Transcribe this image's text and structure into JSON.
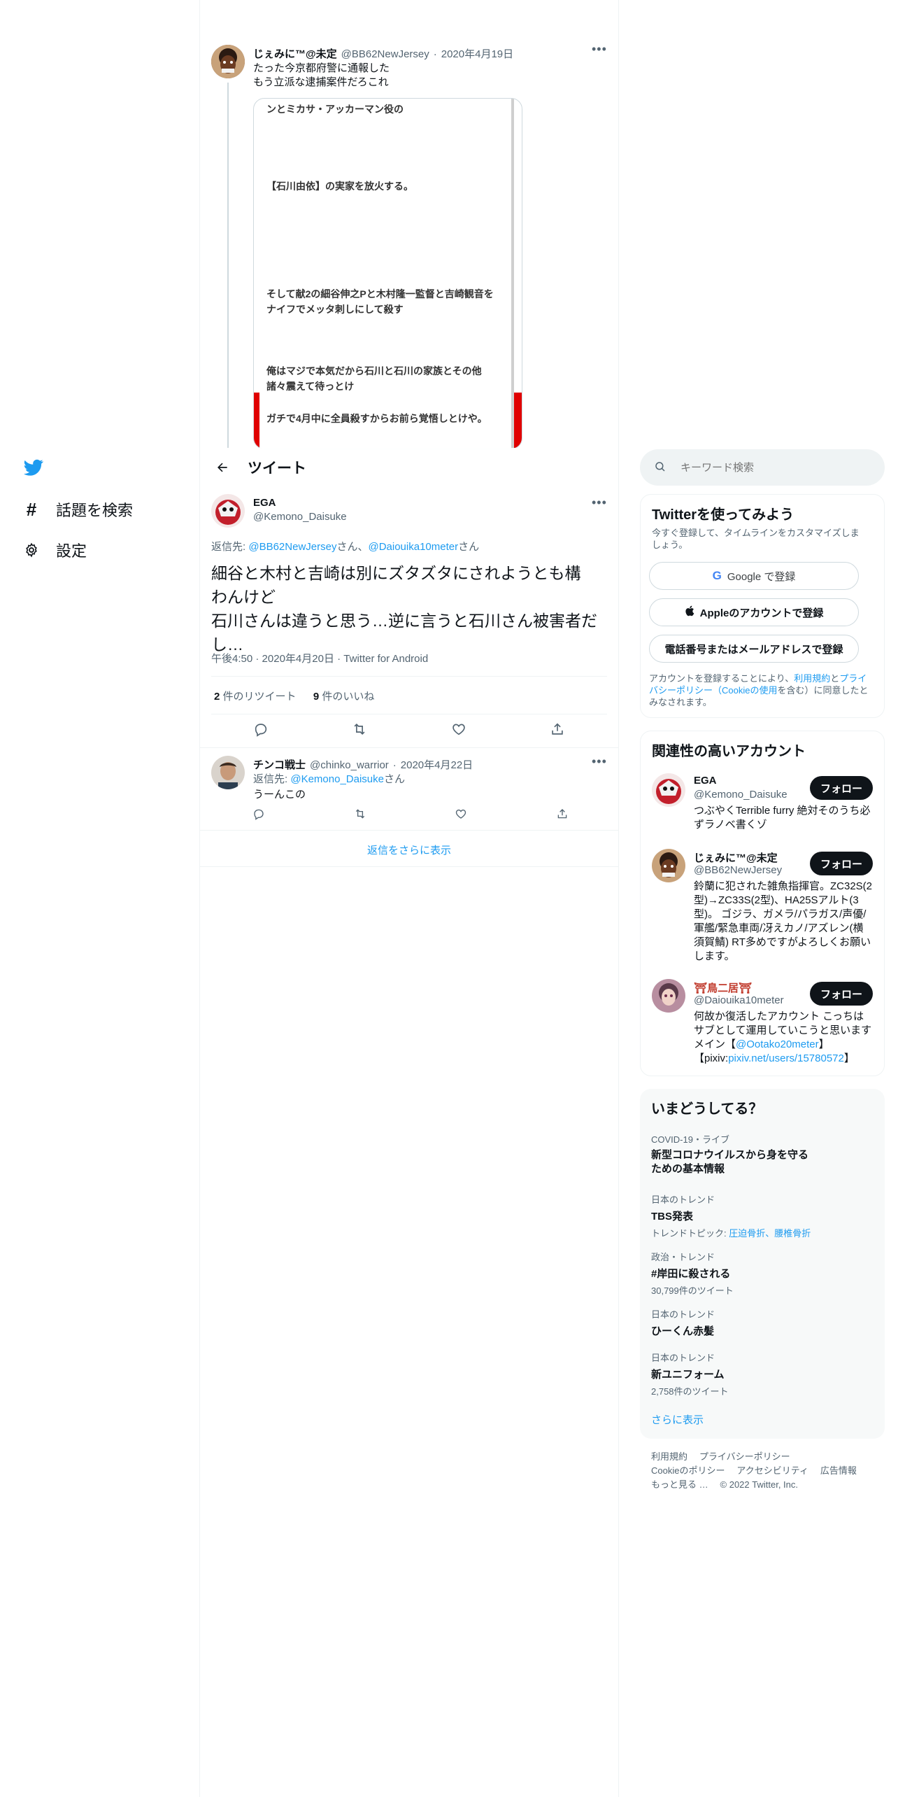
{
  "nav": {
    "explore_label": "話題を検索",
    "settings_label": "設定"
  },
  "parent_tweet": {
    "name": "じぇみに™@未定",
    "handle": "@BB62NewJersey",
    "date": "2020年4月19日",
    "text_line1": "たった今京都府警に通報した",
    "text_line2": "もう立派な逮捕案件だろこれ",
    "image_lines": [
      "ンとミカサ・アッカーマン役の",
      "【石川由依】の実家を放火する。",
      "そして献2の細谷伸之Pと木村隆一監督と吉崎観音を",
      "ナイフでメッタ刺しにして殺す",
      "俺はマジで本気だから石川と石川の家族とその他",
      "諸々震えて待っとけ",
      "ガチで4月中に全員殺すからお前ら覚悟しとけや。"
    ]
  },
  "header": {
    "title": "ツイート"
  },
  "main_tweet": {
    "name": "EGA",
    "handle": "@Kemono_Daisuke",
    "reply_prefix": "返信先: ",
    "reply_to_1": "@BB62NewJersey",
    "reply_sep": "さん、",
    "reply_to_2": "@Daiouika10meter",
    "reply_suffix": "さん",
    "text_line1": "細谷と木村と吉崎は別にズタズタにされようとも構",
    "text_line2": "わんけど",
    "text_line3": "石川さんは違うと思う…逆に言うと石川さん被害者だ",
    "text_line4": "し…",
    "time": "午後4:50",
    "date": "2020年4月20日",
    "client": "Twitter for Android",
    "retweet_count": "2",
    "retweet_label": "件のリツイート",
    "like_count": "9",
    "like_label": "件のいいね"
  },
  "reply_tweet": {
    "name": "チンコ戦士",
    "handle": "@chinko_warrior",
    "date": "2020年4月22日",
    "reply_prefix": "返信先: ",
    "reply_to": "@Kemono_Daisuke",
    "reply_suffix": "さん",
    "text": "うーんこの"
  },
  "show_more_replies": "返信をさらに表示",
  "search": {
    "placeholder": "キーワード検索"
  },
  "signup": {
    "title": "Twitterを使ってみよう",
    "subtitle_line1": "今すぐ登録して、タイムラインをカスタマイズしま",
    "subtitle_line2": "しょう。",
    "google_label": "Google で登録",
    "apple_label": "Appleのアカウントで登録",
    "phone_label": "電話番号またはメールアドレスで登録",
    "legal_line1_a": "アカウントを登録することにより、",
    "legal_terms": "利用規約",
    "legal_and": "と",
    "legal_privacy": "プライ",
    "legal_line2_a": "バシーポリシー（Cookieの使用",
    "legal_line2_b": "を含む）に同意したと",
    "legal_line3": "みなされます。"
  },
  "related": {
    "title": "関連性の高いアカウント",
    "follow_label": "フォロー",
    "accounts": [
      {
        "name": "EGA",
        "handle": "@Kemono_Daisuke",
        "bio1": "つぶやくTerrible furry 絶対そのうち必",
        "bio2": "ずラノベ書くゾ"
      },
      {
        "name": "じぇみに™@未定",
        "handle": "@BB62NewJersey",
        "bio1": "鈴蘭に犯された雑魚指揮官。ZC32S(2",
        "bio2": "型)→ZC33S(2型)、HA25Sアルト(3",
        "bio3": "型)。 ゴジラ、ガメラ/パラガス/声優/",
        "bio4": "軍艦/緊急車両/冴えカノ/アズレン(横",
        "bio5": "須賀鯖) RT多めですがよろしくお願い",
        "bio6": "します。"
      },
      {
        "name": "⛩鳥二居⛩",
        "handle": "@Daiouika10meter",
        "bio1": "何故か復活したアカウント こっちは",
        "bio2": "サブとして運用していこうと思います",
        "bio3_a": "メイン【",
        "bio3_link": "@Ootako20meter",
        "bio3_b": "】",
        "bio4_a": "【pixiv:",
        "bio4_link": "pixiv.net/users/15780572",
        "bio4_b": "】"
      }
    ]
  },
  "trends": {
    "title": "いまどうしてる？",
    "items": [
      {
        "meta": "COVID-19・ライブ",
        "name_line1": "新型コロナウイルスから身を守る",
        "name_line2": "ための基本情報"
      },
      {
        "meta": "日本のトレンド",
        "name": "TBS発表",
        "sub_prefix": "トレンドトピック: ",
        "sub_link": "圧迫骨折、腰椎骨折"
      },
      {
        "meta": "政治・トレンド",
        "name": "#岸田に殺される",
        "sub": "30,799件のツイート"
      },
      {
        "meta": "日本のトレンド",
        "name": "ひーくん赤髪"
      },
      {
        "meta": "日本のトレンド",
        "name": "新ユニフォーム",
        "sub": "2,758件のツイート"
      }
    ],
    "show_more": "さらに表示"
  },
  "footer": {
    "terms": "利用規約",
    "privacy": "プライバシーポリシー",
    "cookie": "Cookieのポリシー",
    "accessibility": "アクセシビリティ",
    "ads": "広告情報",
    "more": "もっと見る …",
    "copyright": "© 2022 Twitter, Inc."
  },
  "colors": {
    "accent": "#1d9bf0",
    "text": "#0f1419",
    "muted": "#536471",
    "card_bg": "#f7f9f9",
    "border": "#eff3f4"
  }
}
